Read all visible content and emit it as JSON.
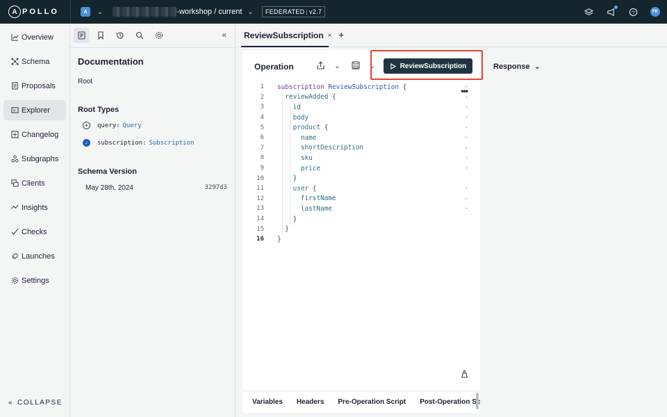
{
  "topbar": {
    "logo_letter": "A",
    "logo_text": "POLLO",
    "org_initial": "A",
    "graph_name": "-workshop / current",
    "badge_type": "FEDERATED",
    "badge_version": "v2.7",
    "user_initials": "FK"
  },
  "sidebar": {
    "items": [
      {
        "label": "Overview",
        "icon": "chart-icon"
      },
      {
        "label": "Schema",
        "icon": "schema-icon"
      },
      {
        "label": "Proposals",
        "icon": "proposals-icon"
      },
      {
        "label": "Explorer",
        "icon": "explorer-icon"
      },
      {
        "label": "Changelog",
        "icon": "changelog-icon"
      },
      {
        "label": "Subgraphs",
        "icon": "subgraphs-icon"
      },
      {
        "label": "Clients",
        "icon": "clients-icon"
      },
      {
        "label": "Insights",
        "icon": "insights-icon"
      },
      {
        "label": "Checks",
        "icon": "checks-icon"
      },
      {
        "label": "Launches",
        "icon": "launches-icon"
      },
      {
        "label": "Settings",
        "icon": "gear-icon"
      }
    ],
    "active": "Explorer",
    "collapse_label": "COLLAPSE"
  },
  "docs": {
    "title": "Documentation",
    "root_label": "Root",
    "root_types_heading": "Root Types",
    "query_field": "query:",
    "query_type": "Query",
    "subscription_field": "subscription:",
    "subscription_type": "Subscription",
    "schema_version_heading": "Schema Version",
    "version_date": "May 28th, 2024",
    "version_hash": "3297d3"
  },
  "tabs": {
    "active_tab": "ReviewSubscription",
    "close_glyph": "×",
    "add_glyph": "+"
  },
  "operation": {
    "title": "Operation",
    "run_label": "ReviewSubscription",
    "current_line": 16
  },
  "code_lines": [
    "subscription ReviewSubscription {",
    "  reviewAdded {",
    "    id",
    "    body",
    "    product {",
    "      name",
    "      shortDescription",
    "      sku",
    "      price",
    "    }",
    "    user {",
    "      firstName",
    "      lastName",
    "    }",
    "  }",
    "}"
  ],
  "footer_tabs": [
    "Variables",
    "Headers",
    "Pre-Operation Script",
    "Post-Operation Script"
  ],
  "response": {
    "label": "Response"
  }
}
